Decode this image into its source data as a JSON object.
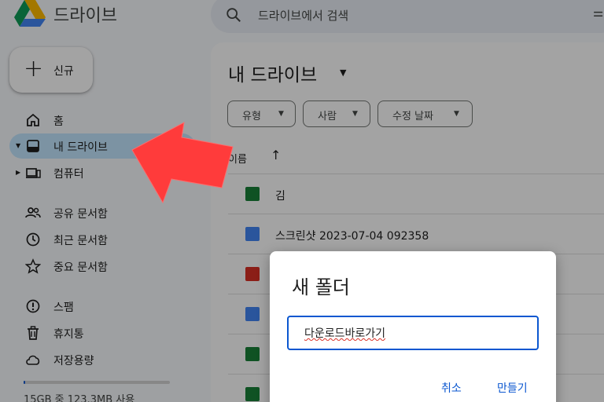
{
  "app": {
    "name": "드라이브",
    "search_placeholder": "드라이브에서 검색",
    "search_tune": "⚌"
  },
  "sidebar": {
    "new_label": "신규",
    "items": [
      {
        "label": "홈",
        "icon": "home-icon"
      },
      {
        "label": "내 드라이브",
        "icon": "my-drive-icon",
        "active": true
      },
      {
        "label": "컴퓨터",
        "icon": "computer-icon"
      },
      {
        "label": "공유 문서함",
        "icon": "shared-icon"
      },
      {
        "label": "최근 문서함",
        "icon": "clock-icon"
      },
      {
        "label": "중요 문서함",
        "icon": "star-icon"
      },
      {
        "label": "스팸",
        "icon": "spam-icon"
      },
      {
        "label": "휴지통",
        "icon": "trash-icon"
      },
      {
        "label": "저장용량",
        "icon": "cloud-icon"
      }
    ],
    "storage_text": "15GB 중 123.3MB 사용",
    "storage_fraction": 0.008
  },
  "main": {
    "title": "내 드라이브",
    "filters": [
      "유형",
      "사람",
      "수정 날짜"
    ],
    "column_name": "이름",
    "files": [
      {
        "name": "김",
        "type": "sheet"
      },
      {
        "name": "스크린샷 2023-07-04 092358",
        "type": "doc"
      },
      {
        "name": "",
        "type": "image"
      },
      {
        "name": "",
        "type": "doc"
      },
      {
        "name": "",
        "type": "sheet"
      },
      {
        "name": "",
        "type": "sheet"
      }
    ]
  },
  "dialog": {
    "title": "새 폴더",
    "input_value": "다운로드바로가기",
    "cancel_label": "취소",
    "create_label": "만들기"
  },
  "colors": {
    "accent": "#0b57d0",
    "active_nav": "#c2e7ff",
    "sheet": "#188038",
    "doc": "#4285f4",
    "image": "#d93025",
    "annotation_arrow": "#ff3b3b"
  }
}
